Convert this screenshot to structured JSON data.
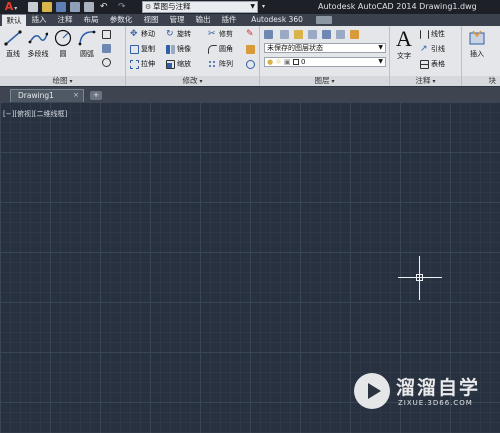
{
  "titlebar": {
    "workspace": "草图与注释",
    "title": "Autodesk AutoCAD 2014    Drawing1.dwg"
  },
  "tabs": [
    "默认",
    "插入",
    "注释",
    "布局",
    "参数化",
    "视图",
    "管理",
    "输出",
    "插件",
    "Autodesk 360"
  ],
  "ribbon": {
    "draw": {
      "title": "绘图",
      "line": "直线",
      "polyline": "多段线",
      "circle": "圆",
      "arc": "圆弧"
    },
    "modify": {
      "title": "修改",
      "move": "移动",
      "rotate": "旋转",
      "trim": "修剪",
      "copy": "复制",
      "mirror": "镜像",
      "fillet": "圆角",
      "stretch": "拉伸",
      "scale": "缩放",
      "array": "阵列"
    },
    "layers": {
      "title": "图层",
      "state": "未保存的图层状态",
      "current": "0"
    },
    "annotation": {
      "title": "注释",
      "text": "文字",
      "linear": "线性",
      "leader": "引线",
      "table": "表格"
    },
    "block": {
      "insert": "插入",
      "title": "块"
    }
  },
  "file_tab": {
    "name": "Drawing1"
  },
  "canvas": {
    "viewport_label": "[−][俯视][二维线框]"
  },
  "watermark": {
    "title": "溜溜自学",
    "url": "ZIXUE.3D66.COM"
  }
}
